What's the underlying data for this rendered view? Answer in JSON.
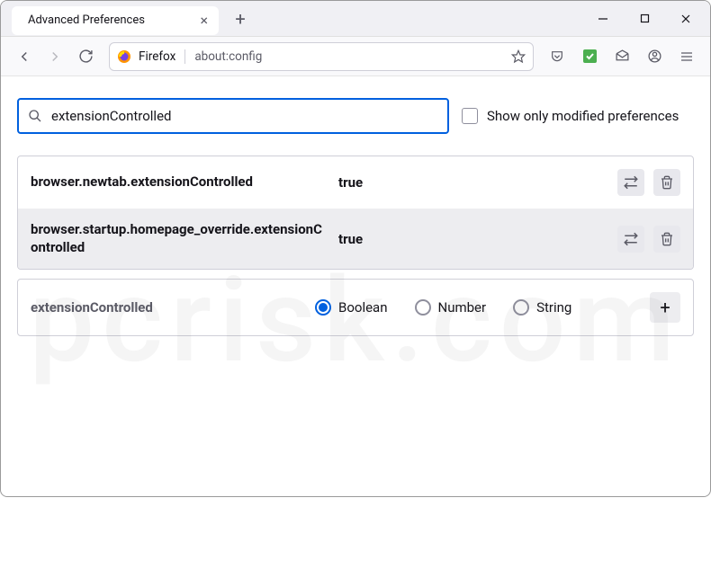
{
  "tab": {
    "title": "Advanced Preferences"
  },
  "urlbar": {
    "prefix": "Firefox",
    "path": "about:config"
  },
  "search": {
    "value": "extensionControlled",
    "show_modified_label": "Show only modified preferences"
  },
  "prefs": [
    {
      "name": "browser.newtab.extensionControlled",
      "value": "true"
    },
    {
      "name": "browser.startup.homepage_override.extensionControlled",
      "value": "true"
    }
  ],
  "new_pref": {
    "name": "extensionControlled",
    "options": [
      {
        "label": "Boolean",
        "selected": true
      },
      {
        "label": "Number",
        "selected": false
      },
      {
        "label": "String",
        "selected": false
      }
    ]
  }
}
